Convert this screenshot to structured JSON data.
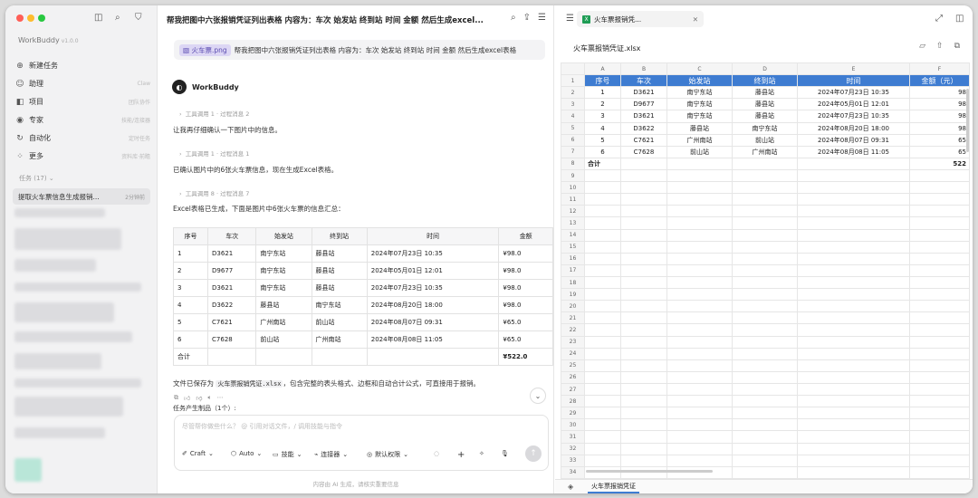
{
  "sidebar": {
    "brand": "WorkBuddy",
    "version": "v1.0.0",
    "nav": [
      {
        "label": "新建任务",
        "hint": "",
        "icon": "plus-icon"
      },
      {
        "label": "助理",
        "hint": "Claw",
        "icon": "assistant-icon"
      },
      {
        "label": "项目",
        "hint": "团队协作",
        "icon": "project-icon"
      },
      {
        "label": "专家",
        "hint": "技能/连接器",
        "icon": "expert-icon"
      },
      {
        "label": "自动化",
        "hint": "定时任务",
        "icon": "automation-icon"
      },
      {
        "label": "更多",
        "hint": "资料库·前瞻",
        "icon": "more-icon"
      }
    ],
    "tasks_label": "任务 (17) ⌄",
    "active_task": {
      "title": "提取火车票信息生成报销...",
      "time": "2分钟前"
    }
  },
  "chat": {
    "title": "帮我把图中六张报销凭证列出表格 内容为：车次 始发站 终到站 时间 金额 然后生成excel...",
    "prompt_chip": "火车票.png",
    "prompt_text": "帮我把图中六张报销凭证列出表格 内容为：车次 始发站 终到站 时间 金额 然后生成excel表格",
    "bot_name": "WorkBuddy",
    "steps": [
      {
        "tools": "工具调用 1",
        "process": "过程消息 2",
        "message": "让我再仔细确认一下图片中的信息。"
      },
      {
        "tools": "工具调用 1",
        "process": "过程消息 1",
        "message": "已确认图片中的6张火车票信息，现在生成Excel表格。"
      },
      {
        "tools": "工具调用 8",
        "process": "过程消息 7",
        "message": "Excel表格已生成，下面是图片中6张火车票的信息汇总："
      }
    ],
    "table": {
      "headers": [
        "序号",
        "车次",
        "始发站",
        "终到站",
        "时间",
        "金额"
      ],
      "rows": [
        [
          "1",
          "D3621",
          "南宁东站",
          "藤县站",
          "2024年07月23日 10:35",
          "¥98.0"
        ],
        [
          "2",
          "D9677",
          "南宁东站",
          "藤县站",
          "2024年05月01日 12:01",
          "¥98.0"
        ],
        [
          "3",
          "D3621",
          "南宁东站",
          "藤县站",
          "2024年07月23日 10:35",
          "¥98.0"
        ],
        [
          "4",
          "D3622",
          "藤县站",
          "南宁东站",
          "2024年08月20日 18:00",
          "¥98.0"
        ],
        [
          "5",
          "C7621",
          "广州南站",
          "前山站",
          "2024年08月07日 09:31",
          "¥65.0"
        ],
        [
          "6",
          "C7628",
          "前山站",
          "广州南站",
          "2024年08月08日 11:05",
          "¥65.0"
        ]
      ],
      "total_label": "合计",
      "total_value": "¥522.0"
    },
    "saved_prefix": "文件已保存为",
    "saved_file": "火车票报销凭证.xlsx",
    "saved_suffix": "，包含完整的表头格式、边框和自动合计公式，可直接用于报销。",
    "output_label": "任务产生制品（1个）:",
    "input_placeholder": "尽管帮你做些什么？ @ 引用对话文件，/ 调用技能与指令",
    "toolbar": {
      "craft": "Craft",
      "auto": "Auto",
      "skills": "技能",
      "connector": "连接器",
      "permission": "默认权限"
    },
    "disclaimer": "内容由 AI 生成，请核实重要信息"
  },
  "viewer": {
    "tab_title": "火车票报销凭...",
    "file_name": "火车票报销凭证.xlsx",
    "columns": [
      "A",
      "B",
      "C",
      "D",
      "E",
      "F"
    ],
    "header_row": [
      "序号",
      "车次",
      "始发站",
      "终到站",
      "时间",
      "金额（元）"
    ],
    "rows": [
      [
        "1",
        "D3621",
        "南宁东站",
        "藤县站",
        "2024年07月23日 10:35",
        "98"
      ],
      [
        "2",
        "D9677",
        "南宁东站",
        "藤县站",
        "2024年05月01日 12:01",
        "98"
      ],
      [
        "3",
        "D3621",
        "南宁东站",
        "藤县站",
        "2024年07月23日 10:35",
        "98"
      ],
      [
        "4",
        "D3622",
        "藤县站",
        "南宁东站",
        "2024年08月20日 18:00",
        "98"
      ],
      [
        "5",
        "C7621",
        "广州南站",
        "前山站",
        "2024年08月07日 09:31",
        "65"
      ],
      [
        "6",
        "C7628",
        "前山站",
        "广州南站",
        "2024年08月08日 11:05",
        "65"
      ]
    ],
    "total_label": "合计",
    "total_value": "522",
    "row_count": 34,
    "sheet_name": "火车票报销凭证"
  },
  "colors": {
    "accent": "#3e7cd1",
    "excel": "#1f9d55",
    "chip": "#dcd6f4"
  }
}
